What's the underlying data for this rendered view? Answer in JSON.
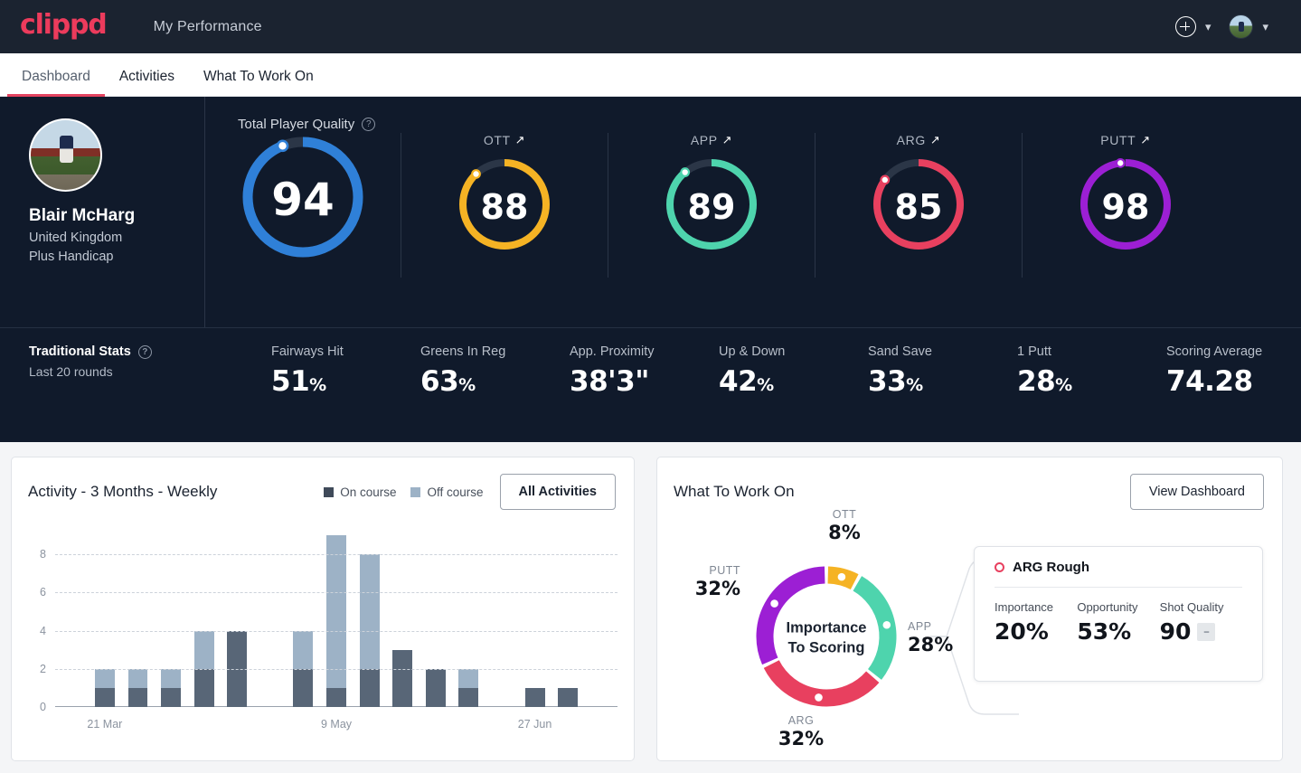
{
  "topbar": {
    "logo": "clippd",
    "nav_title": "My Performance",
    "add_icon": "plus-circle-icon",
    "caret_icon": "chevron-down-icon"
  },
  "tabs": [
    {
      "label": "Dashboard",
      "active": true
    },
    {
      "label": "Activities",
      "active": false
    },
    {
      "label": "What To Work On",
      "active": false
    }
  ],
  "profile": {
    "name": "Blair McHarg",
    "country": "United Kingdom",
    "handicap": "Plus Handicap"
  },
  "quality": {
    "section_label": "Total Player Quality",
    "help_icon": "question-circle-icon",
    "main": {
      "label": "Total Player Quality",
      "value": "94",
      "color": "#2f80d8",
      "pct": 94
    },
    "subs": [
      {
        "label": "OTT",
        "value": "88",
        "color": "#f5b324",
        "pct": 88,
        "trend_icon": "trend-up-icon"
      },
      {
        "label": "APP",
        "value": "89",
        "color": "#4ed4ad",
        "pct": 89,
        "trend_icon": "trend-up-icon"
      },
      {
        "label": "ARG",
        "value": "85",
        "color": "#e8405f",
        "pct": 85,
        "trend_icon": "trend-up-icon"
      },
      {
        "label": "PUTT",
        "value": "98",
        "color": "#9c1fd4",
        "pct": 98,
        "trend_icon": "trend-up-icon"
      }
    ]
  },
  "traditional": {
    "title": "Traditional Stats",
    "help_icon": "question-circle-icon",
    "subtitle": "Last 20 rounds",
    "stats": [
      {
        "label": "Fairways Hit",
        "value": "51",
        "unit": "%"
      },
      {
        "label": "Greens In Reg",
        "value": "63",
        "unit": "%"
      },
      {
        "label": "App. Proximity",
        "value": "38'3\"",
        "unit": ""
      },
      {
        "label": "Up & Down",
        "value": "42",
        "unit": "%"
      },
      {
        "label": "Sand Save",
        "value": "33",
        "unit": "%"
      },
      {
        "label": "1 Putt",
        "value": "28",
        "unit": "%"
      },
      {
        "label": "Scoring Average",
        "value": "74.28",
        "unit": ""
      }
    ]
  },
  "activity_card": {
    "title": "Activity - 3 Months - Weekly",
    "legend": [
      {
        "label": "On course",
        "color": "#3f4a59"
      },
      {
        "label": "Off course",
        "color": "#9db2c6"
      }
    ],
    "button": "All Activities"
  },
  "wtwo_card": {
    "title": "What To Work On",
    "button": "View Dashboard",
    "center_line1": "Importance",
    "center_line2": "To Scoring",
    "detail": {
      "title": "ARG Rough",
      "marker_icon": "circle-outline-icon",
      "stats": [
        {
          "label": "Importance",
          "value": "20%"
        },
        {
          "label": "Opportunity",
          "value": "53%"
        },
        {
          "label": "Shot Quality",
          "value": "90",
          "chip": "–"
        }
      ]
    }
  },
  "chart_data": [
    {
      "type": "bar",
      "title": "Activity - 3 Months - Weekly",
      "stacked": true,
      "xlabel": "",
      "ylabel": "",
      "ylim": [
        0,
        9
      ],
      "yticks": [
        0,
        2,
        4,
        6,
        8
      ],
      "grid": true,
      "legend_position": "top-right",
      "categories": [
        "w1",
        "w2",
        "w3",
        "w4",
        "w5",
        "w6",
        "w7",
        "w8",
        "w9",
        "w10",
        "w11",
        "w12",
        "w13",
        "w14",
        "w15",
        "w16"
      ],
      "tick_labels": [
        {
          "category": "w2",
          "label": "21 Mar"
        },
        {
          "category": "w9",
          "label": "9 May"
        },
        {
          "category": "w15",
          "label": "27 Jun"
        }
      ],
      "series": [
        {
          "name": "On course",
          "color": "#586677",
          "values": [
            0,
            1,
            1,
            1,
            2,
            4,
            0,
            2,
            1,
            2,
            3,
            2,
            1,
            0,
            1,
            1,
            0
          ]
        },
        {
          "name": "Off course",
          "color": "#9db2c6",
          "values": [
            0,
            1,
            1,
            1,
            2,
            0,
            0,
            2,
            8,
            6,
            0,
            0,
            1,
            0,
            0,
            0,
            0
          ]
        }
      ],
      "totals": [
        0,
        2,
        2,
        2,
        4,
        4,
        0,
        4,
        9,
        8,
        3,
        2,
        2,
        0,
        1,
        1,
        0
      ]
    },
    {
      "type": "pie",
      "title": "Importance To Scoring",
      "donut": true,
      "legend_position": "around",
      "labels": [
        "OTT",
        "APP",
        "ARG",
        "PUTT"
      ],
      "values": [
        8,
        28,
        32,
        32
      ],
      "display_values": [
        "8%",
        "28%",
        "32%",
        "32%"
      ],
      "colors": [
        "#f5b324",
        "#4ed4ad",
        "#e8405f",
        "#9c1fd4"
      ]
    }
  ]
}
